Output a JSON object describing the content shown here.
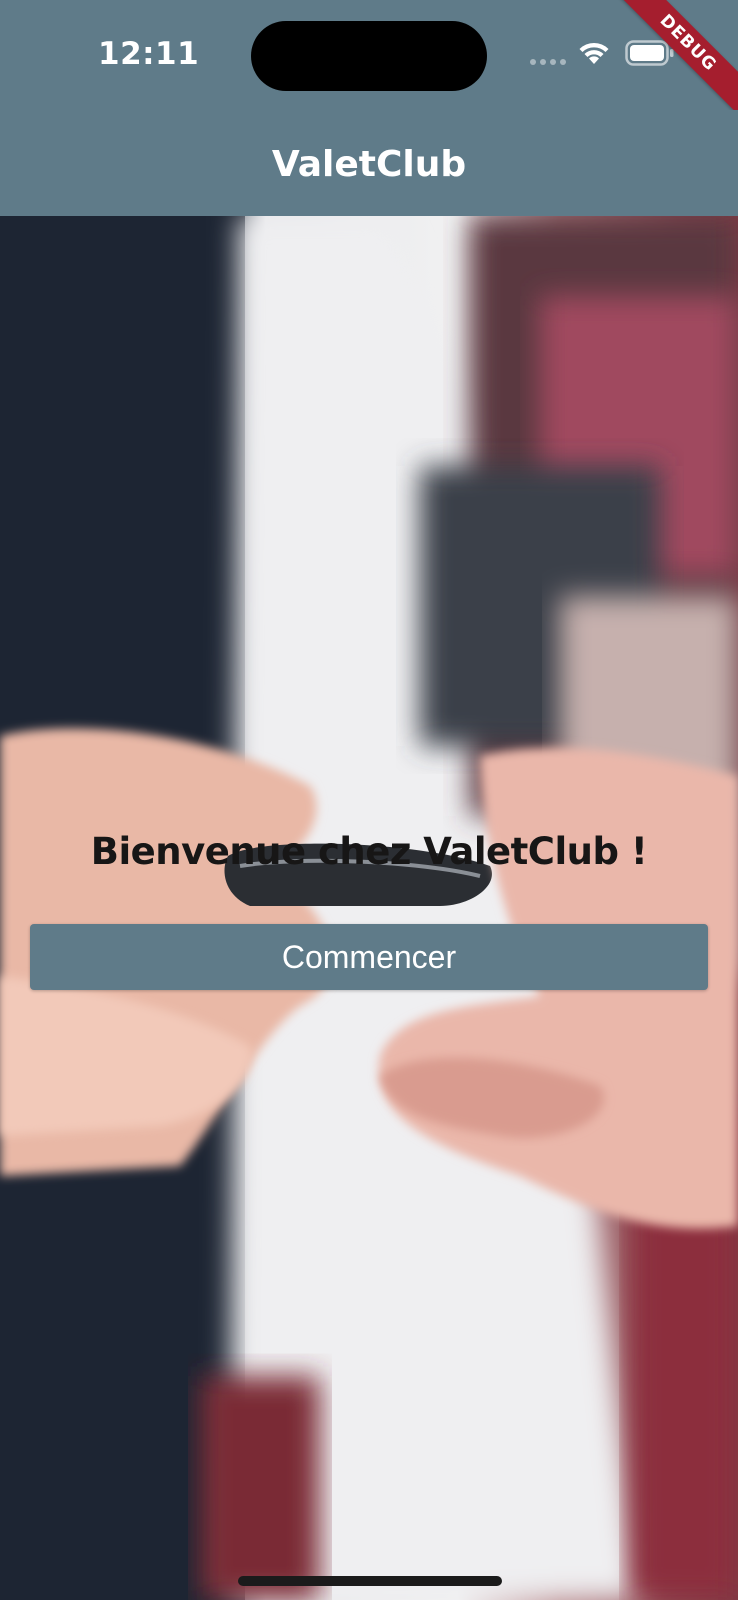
{
  "status_bar": {
    "time": "12:11",
    "signal_icon": "cellular-signal-icon",
    "wifi_icon": "wifi-icon",
    "battery_icon": "battery-icon",
    "debug_label": "DEBUG"
  },
  "app_bar": {
    "title": "ValetClub"
  },
  "main": {
    "background_image": "valet-key-handover-photo",
    "welcome_text": "Bienvenue chez ValetClub !",
    "start_button_label": "Commencer"
  },
  "colors": {
    "primary": "#5f7b89",
    "on_primary": "#ffffff",
    "heading_text": "#171616",
    "debug_ribbon": "#a51e2e"
  }
}
